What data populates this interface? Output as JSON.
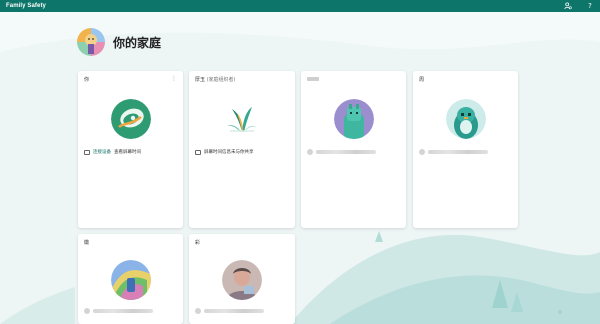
{
  "app": {
    "title": "Family Safety"
  },
  "titlebar": {
    "account_icon": "person-settings-icon",
    "help_label": "?"
  },
  "page": {
    "title": "你的家庭"
  },
  "members": [
    {
      "name": "你",
      "name_suffix": "",
      "status_link": "连接设备",
      "status_text": "查看屏幕时间",
      "avatar": "sloth-avatar"
    },
    {
      "name": "厚玉",
      "name_suffix": "(家庭组织者)",
      "status_link": "",
      "status_text": "屏幕时间信息未与你共享",
      "avatar": "plant-avatar"
    },
    {
      "name": "",
      "name_suffix": "",
      "status_link": "",
      "status_text": "",
      "avatar": "llama-avatar-blurred"
    },
    {
      "name": "周",
      "name_suffix": "",
      "status_link": "",
      "status_text": "",
      "avatar": "penguin-avatar-blurred"
    },
    {
      "name": "徽",
      "name_suffix": "",
      "status_link": "",
      "status_text": "",
      "avatar": "colorful-avatar-blurred"
    },
    {
      "name": "彩",
      "name_suffix": "",
      "status_link": "",
      "status_text": "",
      "avatar": "person-photo-blurred"
    }
  ],
  "colors": {
    "brand": "#0d7569",
    "accent": "#0a6b60",
    "background": "#eef5f5"
  }
}
